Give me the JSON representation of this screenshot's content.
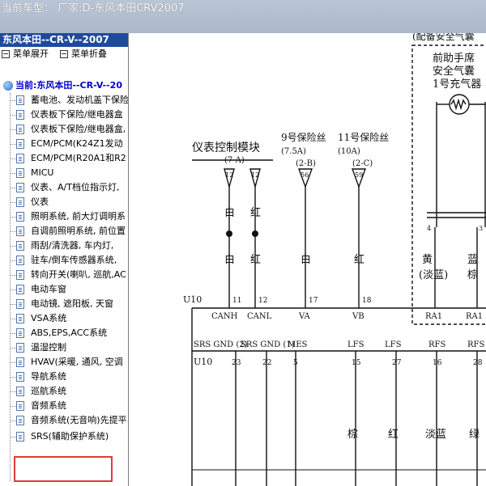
{
  "window": {
    "title": "当前车型：  厂家:D-东风本田CRV2007"
  },
  "sidebar": {
    "car_header": "东风本田--CR-V--2007",
    "expand_label": "菜单展开",
    "collapse_label": "菜单折叠",
    "root_label": "当前:东风本田--CR-V--20",
    "items": [
      "蓄电池、发动机盖下保险",
      "仪表板下保险/继电器盒",
      "仪表板下保险/继电器盒,",
      "ECM/PCM(K24Z1发动",
      "ECM/PCM(R20A1和R2",
      "MICU",
      "仪表、A/T档位指示灯,",
      "仪表",
      "照明系统, 前大灯调明系",
      "自调前照明系统, 前位置",
      "雨刮/清洗器, 车内灯,",
      "驻车/倒车传感器系统,",
      "转向开关(喇叭, 巡航,AC",
      "电动车窗",
      "电动镜, 遮阳板, 天窗",
      "VSA系统",
      "ABS,EPS,ACC系统",
      "温湿控制",
      "HVAV(采暖, 通风, 空调",
      "导航系统",
      "巡航系统",
      "音频系统",
      "音频系统(无音响)先提平",
      "SRS(辅助保护系统)"
    ]
  },
  "diagram": {
    "top_label": "(配备安全气囊",
    "squib_label_1": "前助手席",
    "squib_label_2": "安全气囊",
    "squib_label_3": "1号充气器",
    "module_label": "仪表控制模块",
    "module_connector": "(7-A)",
    "fuse9_label": "9号保险丝",
    "fuse9_rating": "(7.5A)",
    "fuse9_connector": "(2-B)",
    "fuse11_label": "11号保险丝",
    "fuse11_rating": "(10A)",
    "fuse11_connector": "(2-C)",
    "pin_12": "12",
    "pin_12b": "12",
    "pin_56": "56",
    "pin_59": "59",
    "wire_white": "白",
    "wire_red": "红",
    "wire_yellow": "黄",
    "wire_light_blue_paren": "(淡蓝)",
    "wire_blue": "蓝",
    "wire_brown": "棕",
    "wire_light_blue": "淡蓝",
    "wire_green": "绿",
    "conn_u10": "U10",
    "conn_u10_b": "U10",
    "pin_11": "11",
    "pin_12c": "12",
    "pin_17": "17",
    "pin_18": "18",
    "pin_4": "4",
    "pin_3": "3",
    "pin_23": "23",
    "pin_22": "22",
    "pin_5": "5",
    "pin_15": "15",
    "pin_27": "27",
    "pin_16": "16",
    "pin_28": "28",
    "sig_canh": "CANH",
    "sig_canl": "CANL",
    "sig_va": "VA",
    "sig_vb": "VB",
    "sig_ra1": "RA1",
    "sig_ra1b": "RA1",
    "row2_srs_gnd2": "SRS GND (2)",
    "row2_srs_gnd1": "SRS GND (1)",
    "row2_mes": "MES",
    "row2_lfs": "LFS",
    "row2_lfs_b": "LFS",
    "row2_rfs": "RFS",
    "row2_rfs_b": "RFS"
  }
}
